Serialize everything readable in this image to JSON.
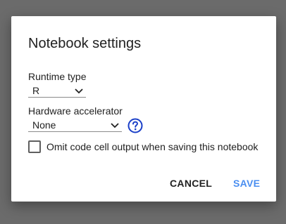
{
  "dialog": {
    "title": "Notebook settings",
    "runtime_type": {
      "label": "Runtime type",
      "selected": "R"
    },
    "hardware_accelerator": {
      "label": "Hardware accelerator",
      "selected": "None"
    },
    "omit_output": {
      "label": "Omit code cell output when saving this notebook",
      "checked": false
    },
    "buttons": {
      "cancel": "CANCEL",
      "save": "SAVE"
    }
  },
  "colors": {
    "backdrop": "#6b6b6b",
    "accent": "#4a8ef0",
    "help_icon": "#1a3fc8"
  },
  "icons": {
    "dropdown": "chevron-down-icon",
    "help": "help-circle-icon"
  }
}
